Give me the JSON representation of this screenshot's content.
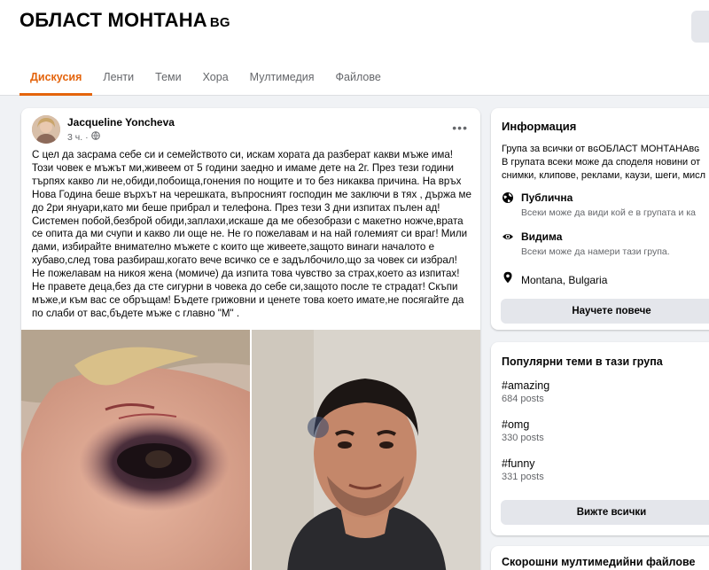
{
  "header": {
    "title": "ОБЛАСТ МОНТАНА",
    "title_suffix": "BG",
    "tabs": [
      {
        "label": "Дискусия",
        "active": true
      },
      {
        "label": "Ленти",
        "active": false
      },
      {
        "label": "Теми",
        "active": false
      },
      {
        "label": "Хора",
        "active": false
      },
      {
        "label": "Мултимедия",
        "active": false
      },
      {
        "label": "Файлове",
        "active": false
      }
    ]
  },
  "post": {
    "author": "Jacqueline Yoncheva",
    "time": "3 ч.",
    "separator": "·",
    "audience_icon": "globe-icon",
    "more_label": "•••",
    "text": "С цел да засрама себе си и семейството си, искам хората да разберат какви мъже има! Този човек е мъжът ми,живеем от 5 години заедно и имаме дете на 2г. През тези години търпях какво ли не,обиди,побоища,гонения по нощите и то без никаква причина. На връх Нова Година беше върхът на черешката, въпросният господин ме заключи в тях , държа ме до 2ри януари,като ми беше прибрал и телефона. През тези 3 дни изпитах пълен ад!  Системен побой,безброй обиди,заплахи,искаше да ме обезобрази с макетно ножче,врата се опита да ми счупи и какво ли още не. Не го пожелавам и на най големият си враг! Мили дами, избирайте внимателно мъжете с които ще живеете,защото винаги началото е хубаво,след това разбираш,когато вече всичко се е задълбочило,що за човек си избрал! Не пожелавам на никоя жена (момиче) да изпита това чувство за страх,което аз изпитах! Не правете деца,без да сте сигурни в човека до себе си,защото после те страдат! Скъпи мъже,и към вас се обръщам! Бъдете грижовни и ценете това което имате,не посягайте да по слаби от вас,бъдете мъже с главно \"М\" ."
  },
  "info": {
    "title": "Информация",
    "desc_line1": "Група за всички от вɢОБЛАСТ МОНТАНАвɢ",
    "desc_line2": "В групата всеки може да споделя новини от",
    "desc_line3": "снимки, клипове, реклами, каузи, шеги, мисл",
    "public_label": "Публична",
    "public_desc": "Всеки може да види кой е в групата и ка",
    "visible_label": "Видима",
    "visible_desc": "Всеки може да намери тази група.",
    "location": "Montana, Bulgaria",
    "learn_more": "Научете повече"
  },
  "topics": {
    "title": "Популярни теми в тази група",
    "items": [
      {
        "tag": "#amazing",
        "count": "684 posts"
      },
      {
        "tag": "#omg",
        "count": "330 posts"
      },
      {
        "tag": "#funny",
        "count": "331 posts"
      }
    ],
    "see_all": "Вижте всички"
  },
  "media": {
    "title": "Скорошни мултимедийни файлове"
  },
  "colors": {
    "accent": "#e4640c",
    "background": "#f0f2f5",
    "card": "#ffffff",
    "muted_text": "#65676b",
    "button_gray": "#e4e6eb"
  }
}
